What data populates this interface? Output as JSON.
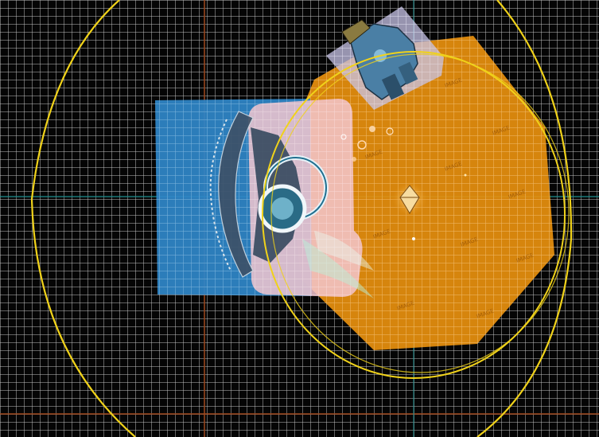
{
  "viewport": {
    "background": "#050505",
    "grid_color": "#d2d2d2",
    "axis_x_color": "#a0481c",
    "axis_y_color": "#1f8f8f"
  },
  "colors": {
    "orange_sprite": "#e8900e",
    "blue_sprite": "#2f86c8",
    "pink_sprite": "#f3c6cf",
    "ring_guides": "#f0d21a",
    "mech_sprite": "#6aa6cc"
  },
  "icons": {
    "orange_sprite": "octagon",
    "blue_sprite": "square",
    "pink_sprite": "rounded-square",
    "ship": "winged-emblem",
    "mech": "mech-figure",
    "gem": "diamond-gem"
  },
  "watermark": {
    "text": "IMAGE"
  }
}
